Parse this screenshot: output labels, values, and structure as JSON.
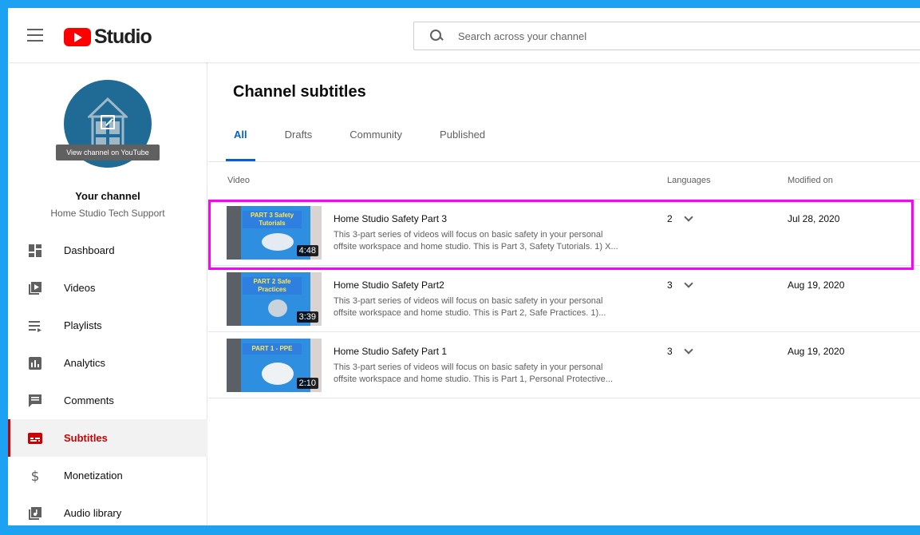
{
  "header": {
    "logo_text": "Studio",
    "search_placeholder": "Search across your channel"
  },
  "sidebar": {
    "tooltip": "View channel on YouTube",
    "channel_title": "Your channel",
    "channel_name": "Home Studio Tech Support",
    "items": [
      {
        "label": "Dashboard",
        "icon": "dashboard-icon"
      },
      {
        "label": "Videos",
        "icon": "videos-icon"
      },
      {
        "label": "Playlists",
        "icon": "playlists-icon"
      },
      {
        "label": "Analytics",
        "icon": "analytics-icon"
      },
      {
        "label": "Comments",
        "icon": "comments-icon"
      },
      {
        "label": "Subtitles",
        "icon": "subtitles-icon",
        "active": true
      },
      {
        "label": "Monetization",
        "icon": "monetization-icon"
      },
      {
        "label": "Audio library",
        "icon": "audio-library-icon"
      }
    ]
  },
  "main": {
    "title": "Channel subtitles",
    "tabs": [
      {
        "label": "All",
        "active": true
      },
      {
        "label": "Drafts"
      },
      {
        "label": "Community"
      },
      {
        "label": "Published"
      }
    ],
    "columns": {
      "video": "Video",
      "languages": "Languages",
      "modified": "Modified on"
    },
    "rows": [
      {
        "thumb_text": "PART 3 Safety Tutorials",
        "duration": "4:48",
        "title": "Home Studio Safety Part 3",
        "desc1": "This 3-part series of videos will focus on basic safety in your personal",
        "desc2": "offsite workspace and home studio. This is Part 3, Safety Tutorials. 1) X...",
        "languages": "2",
        "modified": "Jul 28, 2020"
      },
      {
        "thumb_text": "PART 2 Safe Practices",
        "duration": "3:39",
        "title": "Home Studio Safety Part2",
        "desc1": "This 3-part series of videos will focus on basic safety in your personal",
        "desc2": "offsite workspace and home studio. This is Part 2, Safe Practices. 1)...",
        "languages": "3",
        "modified": "Aug 19, 2020"
      },
      {
        "thumb_text": "PART 1 - PPE",
        "duration": "2:10",
        "title": "Home Studio Safety Part 1",
        "desc1": "This 3-part series of videos will focus on basic safety in your personal",
        "desc2": "offsite workspace and home studio. This is Part 1, Personal Protective...",
        "languages": "3",
        "modified": "Aug 19, 2020"
      }
    ]
  },
  "colors": {
    "accent": "#065fd4",
    "active_nav": "#cc0000",
    "highlight_border": "#ff00ff",
    "outer_background": "#1da1f2"
  }
}
